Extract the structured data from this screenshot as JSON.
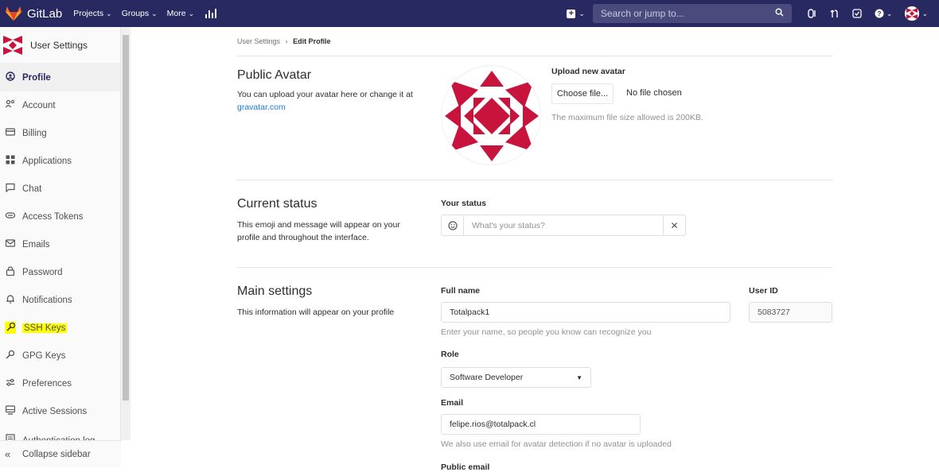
{
  "topbar": {
    "brand": "GitLab",
    "nav": [
      {
        "label": "Projects"
      },
      {
        "label": "Groups"
      },
      {
        "label": "More"
      }
    ],
    "search_placeholder": "Search or jump to...",
    "icons": [
      "plus-icon",
      "search-icon",
      "issues-icon",
      "merge-request-icon",
      "todos-icon",
      "help-icon",
      "user-avatar-icon"
    ]
  },
  "sidebar": {
    "title": "User Settings",
    "items": [
      {
        "label": "Profile",
        "icon": "profile-icon",
        "active": true
      },
      {
        "label": "Account",
        "icon": "account-icon"
      },
      {
        "label": "Billing",
        "icon": "billing-icon"
      },
      {
        "label": "Applications",
        "icon": "applications-icon"
      },
      {
        "label": "Chat",
        "icon": "chat-icon"
      },
      {
        "label": "Access Tokens",
        "icon": "token-icon"
      },
      {
        "label": "Emails",
        "icon": "email-icon"
      },
      {
        "label": "Password",
        "icon": "lock-icon"
      },
      {
        "label": "Notifications",
        "icon": "bell-icon"
      },
      {
        "label": "SSH Keys",
        "icon": "key-icon",
        "highlighted": true
      },
      {
        "label": "GPG Keys",
        "icon": "key-icon"
      },
      {
        "label": "Preferences",
        "icon": "preferences-icon"
      },
      {
        "label": "Active Sessions",
        "icon": "monitor-icon"
      },
      {
        "label": "Authentication log",
        "icon": "log-icon"
      }
    ],
    "collapse_label": "Collapse sidebar"
  },
  "breadcrumb": {
    "parent": "User Settings",
    "separator": "›",
    "current": "Edit Profile"
  },
  "avatar_section": {
    "title": "Public Avatar",
    "desc": "You can upload your avatar here or change it at",
    "link": "gravatar.com",
    "upload_label": "Upload new avatar",
    "choose_button": "Choose file...",
    "no_file": "No file chosen",
    "hint": "The maximum file size allowed is 200KB."
  },
  "status_section": {
    "title": "Current status",
    "desc": "This emoji and message will appear on your profile and throughout the interface.",
    "label": "Your status",
    "placeholder": "What's your status?",
    "clear": "✕"
  },
  "main_section": {
    "title": "Main settings",
    "desc": "This information will appear on your profile",
    "full_name_label": "Full name",
    "full_name_value": "Totalpack1",
    "full_name_hint": "Enter your name, so people you know can recognize you",
    "user_id_label": "User ID",
    "user_id_value": "5083727",
    "role_label": "Role",
    "role_value": "Software Developer",
    "email_label": "Email",
    "email_value": "felipe.rios@totalpack.cl",
    "email_hint": "We also use email for avatar detection if no avatar is uploaded",
    "public_email_label": "Public email"
  },
  "colors": {
    "topbar": "#292961",
    "avatar_red": "#c8143c",
    "highlight": "#ffff00",
    "link": "#1f78d1"
  }
}
